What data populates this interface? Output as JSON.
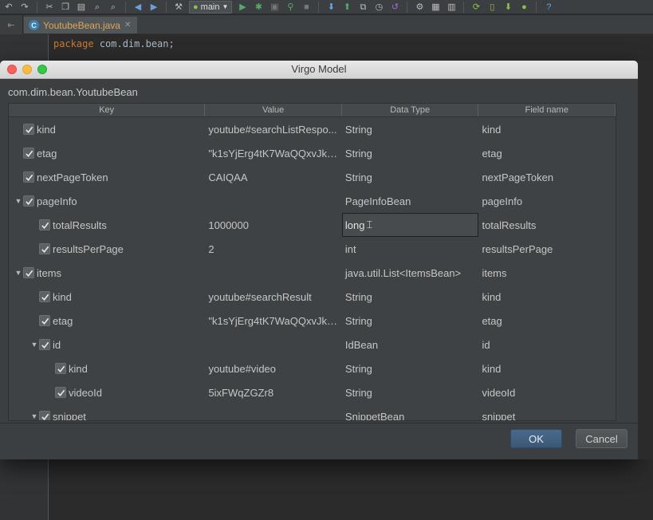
{
  "toolbar": {
    "run_config": "main"
  },
  "editor": {
    "tab_label": "YoutubeBean.java",
    "tab_badge": "C",
    "code_keyword": "package",
    "code_rest": "com.dim.bean;"
  },
  "dialog": {
    "title": "Virgo Model",
    "class_path": "com.dim.bean.YoutubeBean",
    "columns": [
      "Key",
      "Value",
      "Data Type",
      "Field name"
    ],
    "rows": [
      {
        "key": "kind",
        "value": "youtube#searchListRespo...",
        "type": "String",
        "field": "kind",
        "checked": true,
        "level": 0,
        "expander": ""
      },
      {
        "key": "etag",
        "value": "\"k1sYjErg4tK7WaQQxvJkW...",
        "type": "String",
        "field": "etag",
        "checked": true,
        "level": 0,
        "expander": ""
      },
      {
        "key": "nextPageToken",
        "value": "CAIQAA",
        "type": "String",
        "field": "nextPageToken",
        "checked": true,
        "level": 0,
        "expander": ""
      },
      {
        "key": "pageInfo",
        "value": "",
        "type": "PageInfoBean",
        "field": "pageInfo",
        "checked": true,
        "level": 0,
        "expander": "▼"
      },
      {
        "key": "totalResults",
        "value": "1000000",
        "type": "long",
        "field": "totalResults",
        "checked": true,
        "level": 1,
        "expander": "",
        "editing": true
      },
      {
        "key": "resultsPerPage",
        "value": "2",
        "type": "int",
        "field": "resultsPerPage",
        "checked": true,
        "level": 1,
        "expander": ""
      },
      {
        "key": "items",
        "value": "",
        "type": "java.util.List<ItemsBean>",
        "field": "items",
        "checked": true,
        "level": 0,
        "expander": "▼"
      },
      {
        "key": "kind",
        "value": "youtube#searchResult",
        "type": "String",
        "field": "kind",
        "checked": true,
        "level": 1,
        "expander": ""
      },
      {
        "key": "etag",
        "value": "\"k1sYjErg4tK7WaQQxvJkW...",
        "type": "String",
        "field": "etag",
        "checked": true,
        "level": 1,
        "expander": ""
      },
      {
        "key": "id",
        "value": "",
        "type": "IdBean",
        "field": "id",
        "checked": true,
        "level": 1,
        "expander": "▼"
      },
      {
        "key": "kind",
        "value": "youtube#video",
        "type": "String",
        "field": "kind",
        "checked": true,
        "level": 2,
        "expander": ""
      },
      {
        "key": "videoId",
        "value": "5ixFWqZGZr8",
        "type": "String",
        "field": "videoId",
        "checked": true,
        "level": 2,
        "expander": ""
      },
      {
        "key": "snippet",
        "value": "",
        "type": "SnippetBean",
        "field": "snippet",
        "checked": true,
        "level": 1,
        "expander": "▼"
      }
    ],
    "ok_label": "OK",
    "cancel_label": "Cancel"
  },
  "colors": {
    "dialog_bg": "#3c3f41",
    "ok_accent": "#3b5775",
    "tab_text": "#e0a55a"
  }
}
